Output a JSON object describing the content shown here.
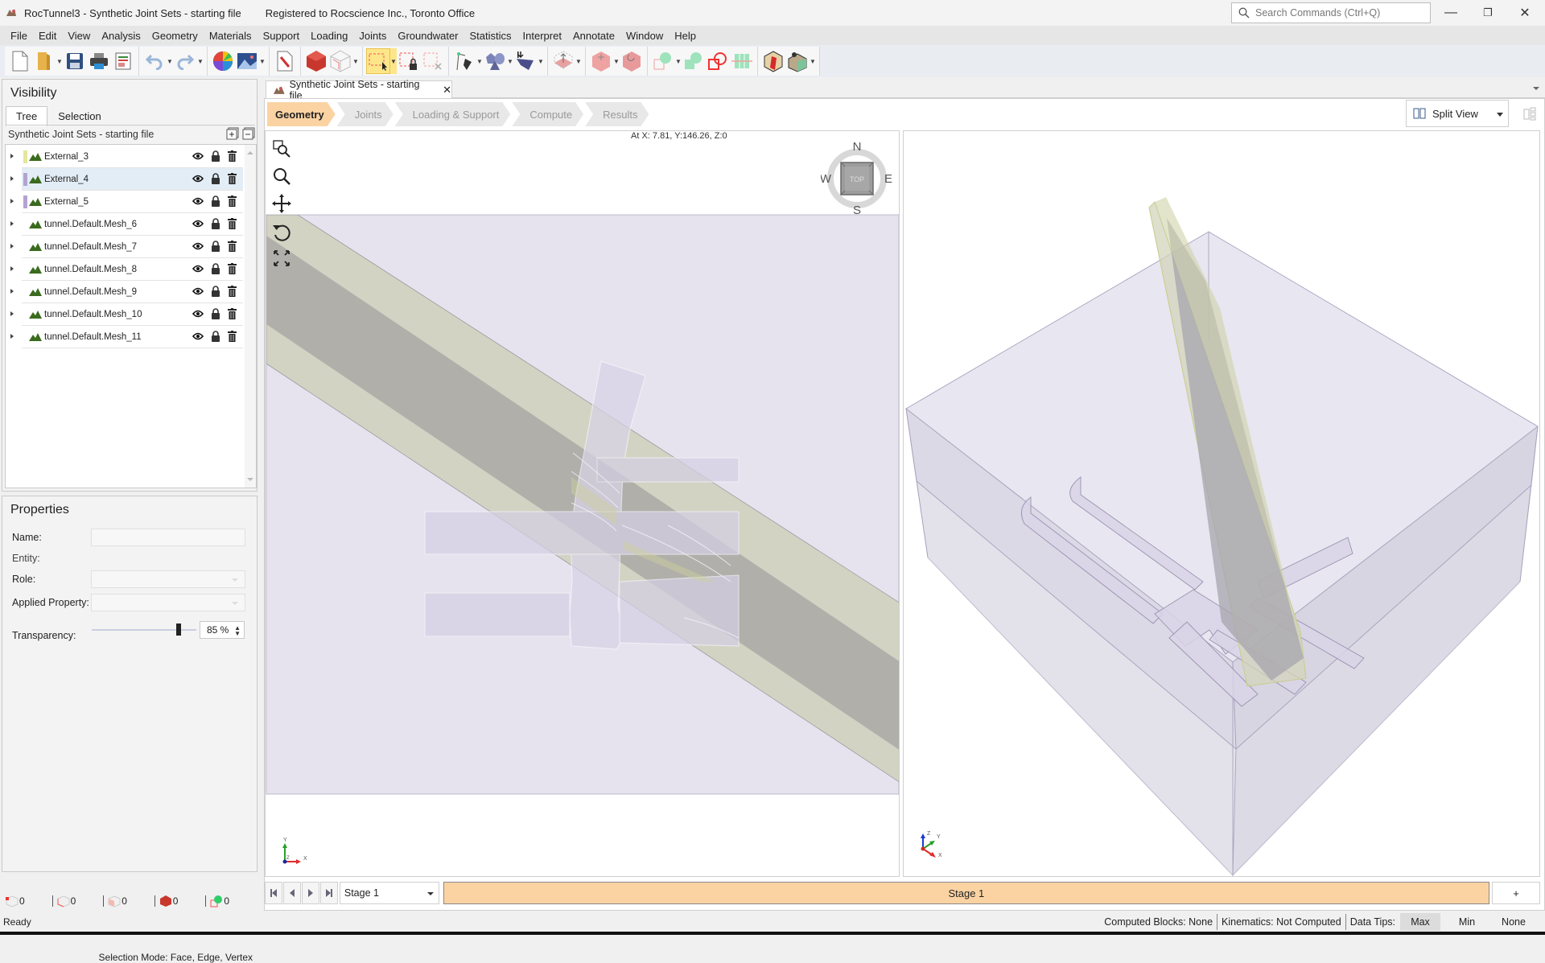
{
  "window": {
    "app_title": "RocTunnel3 - Synthetic Joint Sets - starting file",
    "registration": "Registered to Rocscience Inc., Toronto Office",
    "search_placeholder": "Search Commands (Ctrl+Q)",
    "controls": {
      "minimize": "—",
      "restore": "❐",
      "close": "✕"
    }
  },
  "menu": [
    "File",
    "Edit",
    "View",
    "Analysis",
    "Geometry",
    "Materials",
    "Support",
    "Loading",
    "Joints",
    "Groundwater",
    "Statistics",
    "Interpret",
    "Annotate",
    "Window",
    "Help"
  ],
  "toolbar": {
    "buttons": [
      "new-file",
      "open-file",
      "save",
      "print",
      "report",
      "undo",
      "redo",
      "color-palette",
      "image-export",
      "edit-document",
      "solid-model",
      "wireframe-box",
      "box-select",
      "lock-selection",
      "clear-selection",
      "polyline-draw",
      "shapes",
      "import-geometry",
      "extrude",
      "move-solid",
      "rotate-solid",
      "boolean-union",
      "boolean-intersect",
      "boolean-subtract",
      "grid-divide",
      "section-tool",
      "paint-tool"
    ],
    "active": "box-select"
  },
  "visibility": {
    "title": "Visibility",
    "tabs": [
      "Tree",
      "Selection"
    ],
    "active_tab": "Tree",
    "tree_header": "Synthetic Joint Sets - starting file",
    "items": [
      {
        "name": "External_3",
        "swatch": "#e3e89a",
        "selected": false
      },
      {
        "name": "External_4",
        "swatch": "#b3a3d1",
        "selected": true
      },
      {
        "name": "External_5",
        "swatch": "#b3a3d1",
        "selected": false
      },
      {
        "name": "tunnel.Default.Mesh_6",
        "swatch": "",
        "selected": false
      },
      {
        "name": "tunnel.Default.Mesh_7",
        "swatch": "",
        "selected": false
      },
      {
        "name": "tunnel.Default.Mesh_8",
        "swatch": "",
        "selected": false
      },
      {
        "name": "tunnel.Default.Mesh_9",
        "swatch": "",
        "selected": false
      },
      {
        "name": "tunnel.Default.Mesh_10",
        "swatch": "",
        "selected": false
      },
      {
        "name": "tunnel.Default.Mesh_11",
        "swatch": "",
        "selected": false
      }
    ]
  },
  "properties": {
    "title": "Properties",
    "name_label": "Name:",
    "name_value": "",
    "entity_label": "Entity:",
    "entity_value": "",
    "role_label": "Role:",
    "role_value": "",
    "applied_label": "Applied Property:",
    "applied_value": "",
    "transparency_label": "Transparency:",
    "transparency_value": "85 %",
    "transparency_percent": 85
  },
  "selection": {
    "mode": "Selection Mode: Face, Edge, Vertex",
    "counts": [
      {
        "type": "vertex",
        "value": "0"
      },
      {
        "type": "edge",
        "value": "0"
      },
      {
        "type": "face",
        "value": "0"
      },
      {
        "type": "solid",
        "value": "0"
      },
      {
        "type": "other",
        "value": "0"
      }
    ]
  },
  "document": {
    "tab_title": "Synthetic Joint Sets - starting file",
    "workflow": [
      {
        "label": "Geometry",
        "active": true
      },
      {
        "label": "Joints",
        "active": false
      },
      {
        "label": "Loading & Support",
        "active": false
      },
      {
        "label": "Compute",
        "active": false
      },
      {
        "label": "Results",
        "active": false
      }
    ],
    "view_mode": "Split View"
  },
  "viewport_2d": {
    "coords": "At X: 7.81, Y:146.26, Z:0",
    "compass": {
      "n": "N",
      "s": "S",
      "e": "E",
      "w": "W",
      "face": "TOP"
    },
    "axes": {
      "x": "X",
      "y": "Y",
      "z": "Z"
    }
  },
  "viewport_3d": {
    "axes": {
      "x": "X",
      "y": "Y",
      "z": "Z"
    }
  },
  "stage": {
    "selected": "Stage 1",
    "band_label": "Stage 1",
    "add_label": "+"
  },
  "status": {
    "ready": "Ready",
    "computed_blocks": "Computed Blocks:  None",
    "kinematics": "Kinematics:  Not Computed",
    "data_tips_label": "Data Tips:",
    "data_tips_options": [
      "Max",
      "Min",
      "None"
    ],
    "data_tips_selected": "Max"
  },
  "colors": {
    "active_stage": "#fbd3a3",
    "joint_band": "#d0d1bf",
    "joint_core": "#adaca8",
    "model_fill": "#e6e3ee",
    "tunnel_fill": "#d8d2e4"
  }
}
